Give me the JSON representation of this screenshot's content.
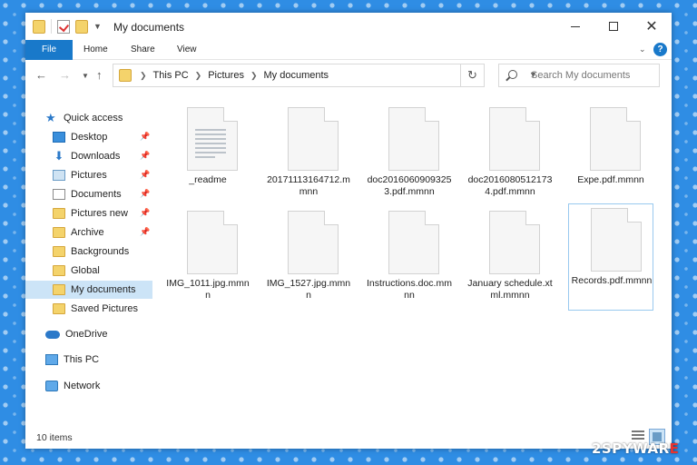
{
  "window": {
    "title": "My documents",
    "controls": {
      "minimize": "minimize",
      "maximize": "maximize",
      "close": "✕"
    }
  },
  "ribbon": {
    "tabs": [
      "File",
      "Home",
      "Share",
      "View"
    ],
    "help": "?"
  },
  "address": {
    "crumbs": [
      "This PC",
      "Pictures",
      "My documents"
    ],
    "search_placeholder": "Search My documents"
  },
  "sidebar": {
    "items": [
      {
        "label": "Quick access",
        "icon": "star-icon",
        "pinned": false
      },
      {
        "label": "Desktop",
        "icon": "desktop-icon",
        "pinned": true
      },
      {
        "label": "Downloads",
        "icon": "download-icon",
        "pinned": true
      },
      {
        "label": "Pictures",
        "icon": "pictures-icon",
        "pinned": true
      },
      {
        "label": "Documents",
        "icon": "documents-icon",
        "pinned": true
      },
      {
        "label": "Pictures new",
        "icon": "folder-icon",
        "pinned": true
      },
      {
        "label": "Archive",
        "icon": "folder-icon",
        "pinned": true
      },
      {
        "label": "Backgrounds",
        "icon": "folder-icon",
        "pinned": false
      },
      {
        "label": "Global",
        "icon": "folder-icon",
        "pinned": false
      },
      {
        "label": "My documents",
        "icon": "folder-icon",
        "pinned": false,
        "selected": true
      },
      {
        "label": "Saved Pictures",
        "icon": "folder-icon",
        "pinned": false
      },
      {
        "label": "OneDrive",
        "icon": "cloud-icon",
        "pinned": false
      },
      {
        "label": "This PC",
        "icon": "pc-icon",
        "pinned": false
      },
      {
        "label": "Network",
        "icon": "network-icon",
        "pinned": false
      }
    ]
  },
  "files": [
    {
      "name": "_readme",
      "icon": "text-document-icon"
    },
    {
      "name": "20171113164712.mmnn",
      "icon": "blank-file-icon"
    },
    {
      "name": "doc20160609093253.pdf.mmnn",
      "icon": "blank-file-icon"
    },
    {
      "name": "doc20160805121734.pdf.mmnn",
      "icon": "blank-file-icon"
    },
    {
      "name": "Expe.pdf.mmnn",
      "icon": "blank-file-icon"
    },
    {
      "name": "IMG_1011.jpg.mmnn",
      "icon": "blank-file-icon"
    },
    {
      "name": "IMG_1527.jpg.mmnn",
      "icon": "blank-file-icon"
    },
    {
      "name": "Instructions.doc.mmnn",
      "icon": "blank-file-icon"
    },
    {
      "name": "January schedule.xtml.mmnn",
      "icon": "blank-file-icon"
    },
    {
      "name": "Records.pdf.mmnn",
      "icon": "blank-file-icon",
      "focused": true
    }
  ],
  "status": {
    "count": "10 items"
  },
  "watermark": {
    "text": "2SPYWAR",
    "accent": "E"
  }
}
